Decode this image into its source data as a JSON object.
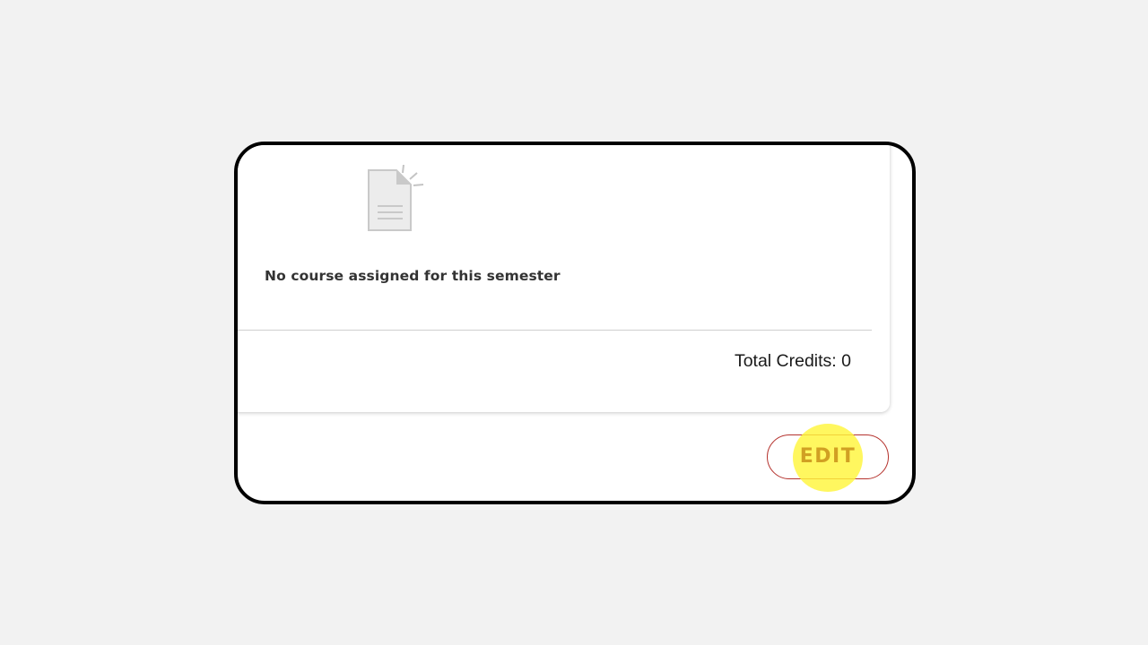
{
  "semester_card": {
    "empty_message": "No course assigned for this semester",
    "empty_icon": "document-empty-icon",
    "total_credits_label": "Total Credits: 0"
  },
  "actions": {
    "edit_label": "EDIT",
    "edit_border_color": "#b5332e",
    "edit_text_color": "#d1a023",
    "highlight_color": "#fff53c"
  }
}
